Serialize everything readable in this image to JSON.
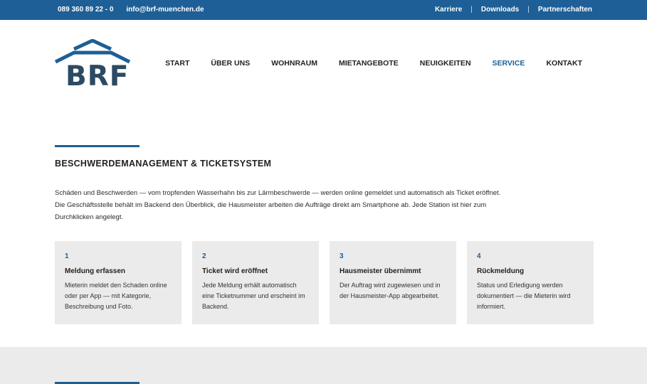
{
  "topbar": {
    "phone": "089 360 89 22 - 0",
    "email": "info@brf-muenchen.de",
    "links": [
      "Karriere",
      "Downloads",
      "Partnerschaften"
    ],
    "separator": "|"
  },
  "logo": {
    "text": "BRF"
  },
  "nav": {
    "items": [
      "START",
      "ÜBER UNS",
      "WOHNRAUM",
      "MIETANGEBOTE",
      "NEUIGKEITEN",
      "SERVICE",
      "KONTAKT"
    ],
    "active": "SERVICE"
  },
  "section": {
    "title": "BESCHWERDEMANAGEMENT & TICKETSYSTEM",
    "intro": "Schäden und Beschwerden — vom tropfenden Wasserhahn bis zur Lärmbeschwerde — werden online gemeldet und automatisch als Ticket eröffnet. Die Geschäftsstelle behält im Backend den Überblick, die Hausmeister arbeiten die Aufträge direkt am Smartphone ab. Jede Station ist hier zum Durchklicken angelegt."
  },
  "steps": [
    {
      "number": "1",
      "title": "Meldung erfassen",
      "text": "Mieterin meldet den Schaden online oder per App — mit Kategorie, Beschreibung und Foto."
    },
    {
      "number": "2",
      "title": "Ticket wird eröffnet",
      "text": "Jede Meldung erhält automatisch eine Ticketnummer und erscheint im Backend."
    },
    {
      "number": "3",
      "title": "Hausmeister übernimmt",
      "text": "Der Auftrag wird zugewiesen und in der Hausmeister-App abgearbeitet."
    },
    {
      "number": "4",
      "title": "Rückmeldung",
      "text": "Status und Erledigung werden dokumentiert — die Mieterin wird informiert."
    }
  ],
  "colors": {
    "brand": "#1d5f96",
    "logo_text": "#2c4a63",
    "card_bg": "#ebebeb"
  }
}
